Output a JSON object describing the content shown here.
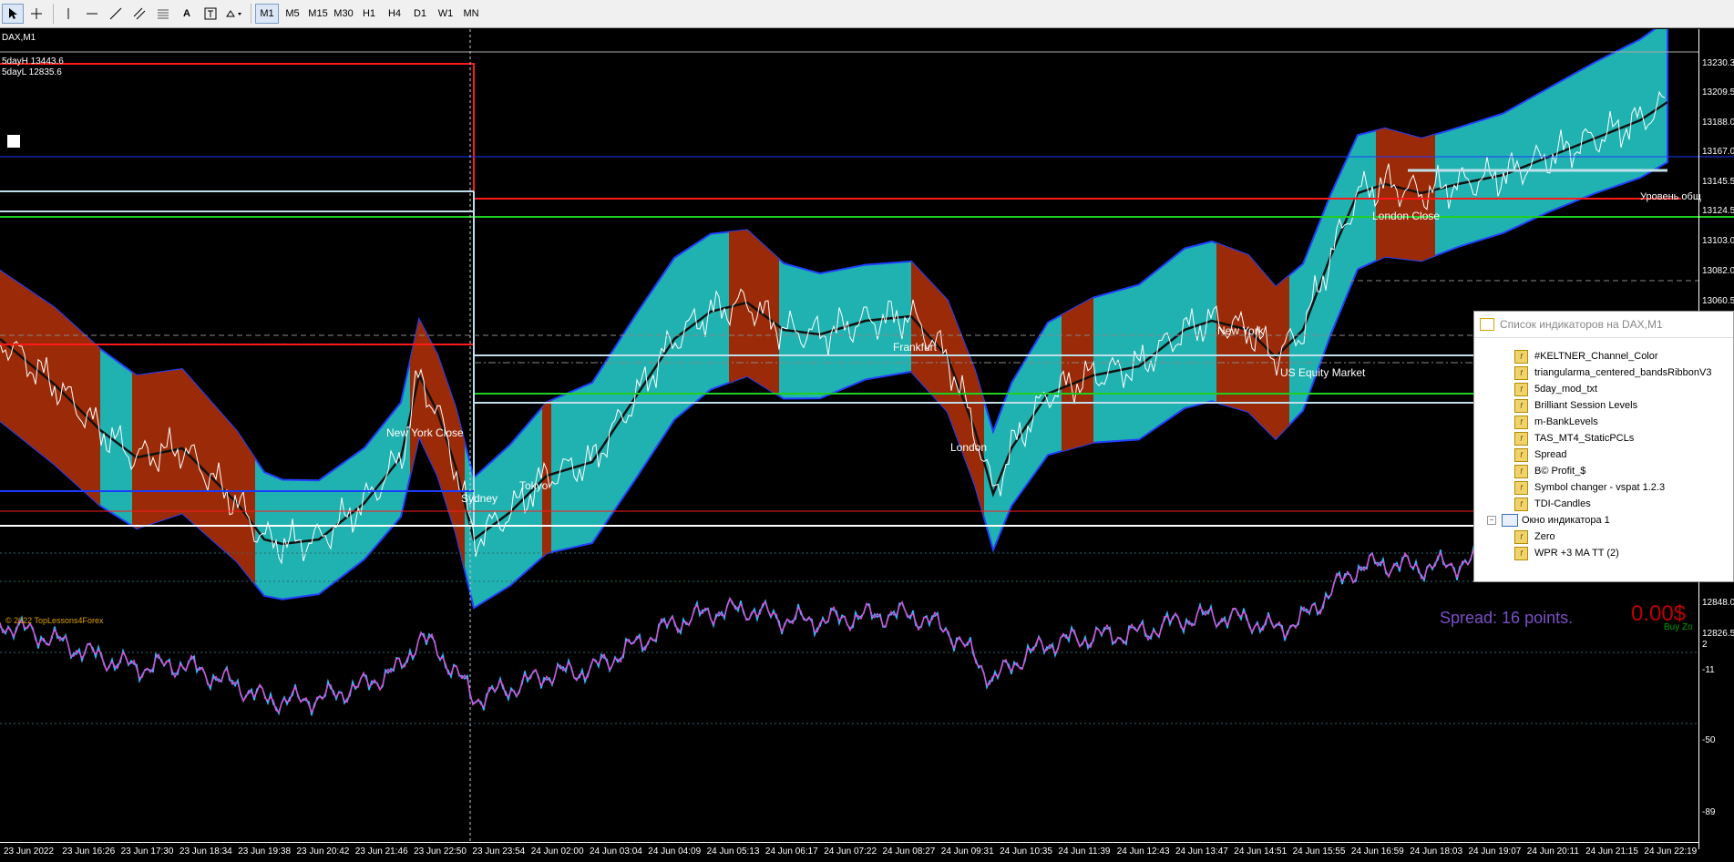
{
  "toolbar": {
    "timeframes": [
      "M1",
      "M5",
      "M15",
      "M30",
      "H1",
      "H4",
      "D1",
      "W1",
      "MN"
    ],
    "active_timeframe": "M1",
    "icons": [
      "cursor-icon",
      "crosshair-icon",
      "vertical-line-icon",
      "horizontal-line-icon",
      "trendline-icon",
      "channel-icon",
      "fibonacci-icon",
      "text-icon",
      "text-label-icon",
      "shapes-icon"
    ]
  },
  "chart": {
    "symbol_title": "DAX,M1",
    "five_day_high": "5dayH 13443.6",
    "five_day_low": "5dayL 12835.6",
    "copyright": "© 2022 TopLessons4Forex",
    "spread_text": "Spread: 16 points.",
    "profit_text": "0.00$",
    "buy_zone_text": "Buy Zo",
    "level_text": "Уровень общ",
    "price_labels": [
      "13230.3",
      "13209.5",
      "13188.0",
      "13167.0",
      "13145.5",
      "13124.5",
      "13103.0",
      "13082.0",
      "13060.5",
      "12848.0",
      "12826.5"
    ],
    "sub_labels": [
      "2",
      "-11",
      "-50",
      "-89"
    ],
    "time_labels": [
      "23 Jun 2022",
      "23 Jun 16:26",
      "23 Jun 17:30",
      "23 Jun 18:34",
      "23 Jun 19:38",
      "23 Jun 20:42",
      "23 Jun 21:46",
      "23 Jun 22:50",
      "23 Jun 23:54",
      "24 Jun 02:00",
      "24 Jun 03:04",
      "24 Jun 04:09",
      "24 Jun 05:13",
      "24 Jun 06:17",
      "24 Jun 07:22",
      "24 Jun 08:27",
      "24 Jun 09:31",
      "24 Jun 10:35",
      "24 Jun 11:39",
      "24 Jun 12:43",
      "24 Jun 13:47",
      "24 Jun 14:51",
      "24 Jun 15:55",
      "24 Jun 16:59",
      "24 Jun 18:03",
      "24 Jun 19:07",
      "24 Jun 20:11",
      "24 Jun 21:15",
      "24 Jun 22:19"
    ],
    "sessions": {
      "new_york_close": "New York Close",
      "sydney": "Sydney",
      "tokyo": "Tokyo",
      "frankfurt": "Frankfurt",
      "london": "London",
      "new_york": "New York",
      "us_equity_market": "US Equity Market",
      "london_close": "London Close"
    },
    "colors": {
      "band": "#20b2b0",
      "bear": "#9a2a08",
      "purple": "#8a1a9a",
      "green": "#107010",
      "border": "#2040ff",
      "red_line": "#ff1a1a",
      "green_line": "#20d020",
      "light_line": "#bfe0ea",
      "wpr": "#d34fd3",
      "wpr2": "#2fb8ff"
    }
  },
  "indicator_panel": {
    "title": "Список индикаторов на DAX,M1",
    "items": [
      "#KELTNER_Channel_Color",
      "triangularma_centered_bandsRibbonV3",
      "5day_mod_txt",
      "Brilliant Session Levels",
      "m-BankLevels",
      "TAS_MT4_StaticPCLs",
      "Spread",
      "B© Profit_$",
      "Symbol changer - vspat 1.2.3",
      "TDI-Candles"
    ],
    "subwindow_label": "Окно индикатора 1",
    "subwindow_items": [
      "Zero",
      "WPR +3 MA TT (2)"
    ]
  }
}
